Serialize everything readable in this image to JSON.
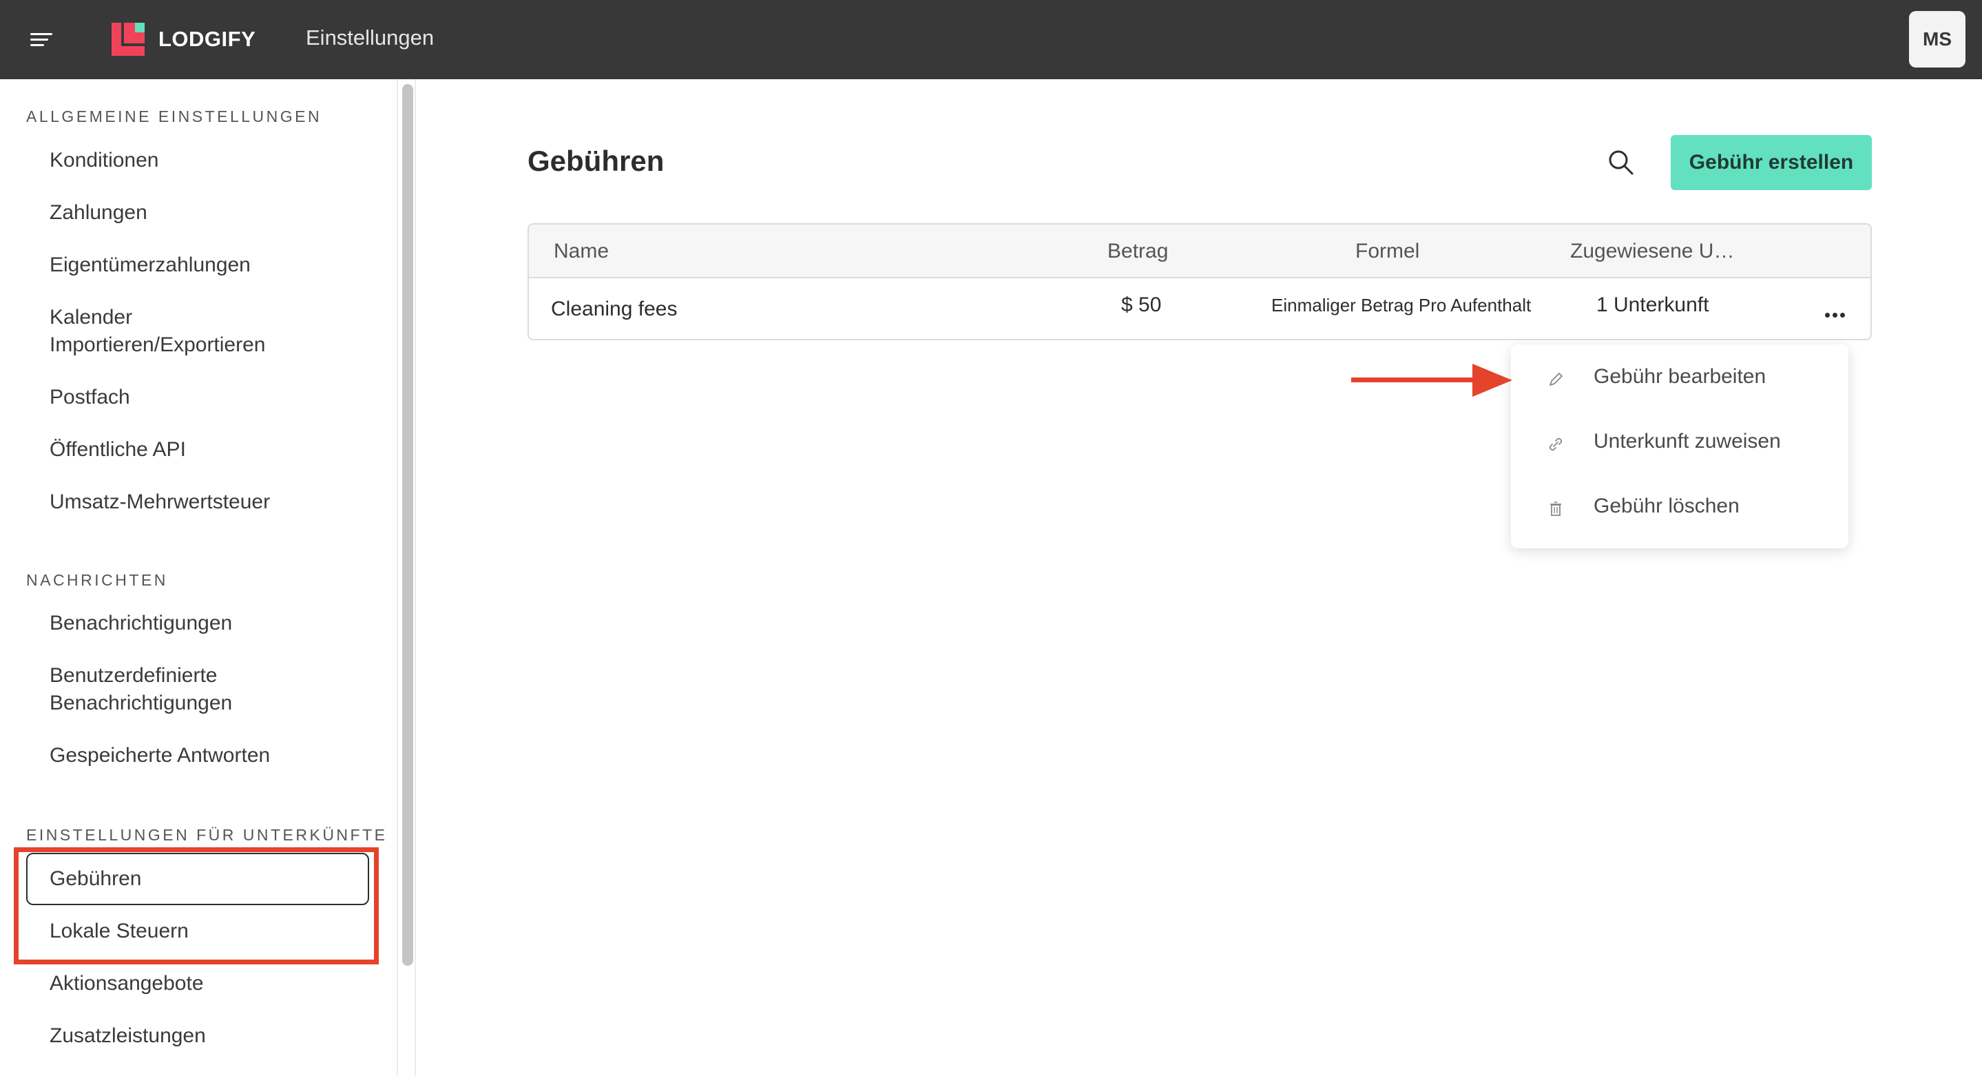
{
  "topbar": {
    "brand": "LODGIFY",
    "title": "Einstellungen",
    "avatar_initials": "MS",
    "logo_colors": {
      "primary": "#f0435a",
      "accent": "#63e0bf"
    }
  },
  "sidebar": {
    "sections": [
      {
        "heading": "ALLGEMEINE EINSTELLUNGEN",
        "items": [
          "Konditionen",
          "Zahlungen",
          "Eigentümerzahlungen",
          "Kalender",
          "Importieren/Exportieren",
          "Postfach",
          "Öffentliche API",
          "Umsatz-Mehrwertsteuer"
        ]
      },
      {
        "heading": "NACHRICHTEN",
        "items": [
          "Benachrichtigungen",
          "Benutzerdefinierte",
          "Benachrichtigungen",
          "Gespeicherte Antworten"
        ]
      },
      {
        "heading": "EINSTELLUNGEN FÜR UNTERKÜNFTE",
        "items": [
          "Gebühren",
          "Lokale Steuern",
          "Aktionsangebote",
          "Zusatzleistungen"
        ]
      }
    ],
    "active_item": "Gebühren"
  },
  "main": {
    "title": "Gebühren",
    "create_button": "Gebühr erstellen",
    "table": {
      "columns": [
        "Name",
        "Betrag",
        "Formel",
        "Zugewiesene U…"
      ],
      "rows": [
        {
          "name": "Cleaning fees",
          "amount": "$ 50",
          "formula": "Einmaliger Betrag Pro Aufenthalt",
          "assigned": "1 Unterkunft"
        }
      ]
    },
    "context_menu": {
      "items": [
        {
          "label": "Gebühr bearbeiten",
          "icon": "pencil-icon"
        },
        {
          "label": "Unterkunft zuweisen",
          "icon": "link-icon"
        },
        {
          "label": "Gebühr löschen",
          "icon": "trash-icon"
        }
      ]
    }
  },
  "annotation_color": "#e5432b"
}
